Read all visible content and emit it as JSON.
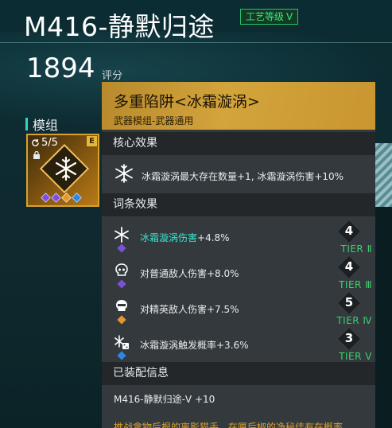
{
  "header": {
    "weapon_name": "M416-静默归途",
    "badge_label": "工艺等级",
    "badge_level": "V",
    "score": "1894",
    "score_label": "评分"
  },
  "module_section": {
    "label": "模组",
    "card": {
      "count": "5/5",
      "rarity": "E",
      "gems": [
        "#7b4fd8",
        "#7b4fd8",
        "#e3962c",
        "#2f86e0"
      ]
    }
  },
  "tooltip": {
    "title": "多重陷阱<冰霜漩涡>",
    "subtitle": "武器模组-武器通用",
    "core_header": "核心效果",
    "core_text": "冰霜漩涡最大存在数量+1, 冰霜漩涡伤害+10%",
    "attr_header": "词条效果",
    "attributes": [
      {
        "highlight": "冰霜漩涡伤害",
        "text": "+4.8%",
        "level": "4",
        "tier": "TIER Ⅱ",
        "gem": "#7b4fd8",
        "icon": "snowflake-icon"
      },
      {
        "highlight": "",
        "text": "对普通敌人伤害+8.0%",
        "level": "4",
        "tier": "TIER Ⅲ",
        "gem": "#7b4fd8",
        "icon": "skull-icon"
      },
      {
        "highlight": "",
        "text": "对精英敌人伤害+7.5%",
        "level": "5",
        "tier": "TIER Ⅳ",
        "gem": "#e3962c",
        "icon": "elite-skull-icon"
      },
      {
        "highlight": "",
        "text": "冰霜漩涡触发概率+3.6%",
        "level": "3",
        "tier": "TIER Ⅴ",
        "gem": "#2f86e0",
        "icon": "frost-trigger-icon"
      }
    ],
    "equip_header": "已装配信息",
    "equip_text": "M416-静默归途-V +10",
    "lore_text": "推战拿物后根的离影猫手，在匣后椒的净秘佳有在概率"
  },
  "colors": {
    "accent_teal": "#36e6cf",
    "tier_green": "#3ad46b",
    "gold": "#d3a43c"
  }
}
